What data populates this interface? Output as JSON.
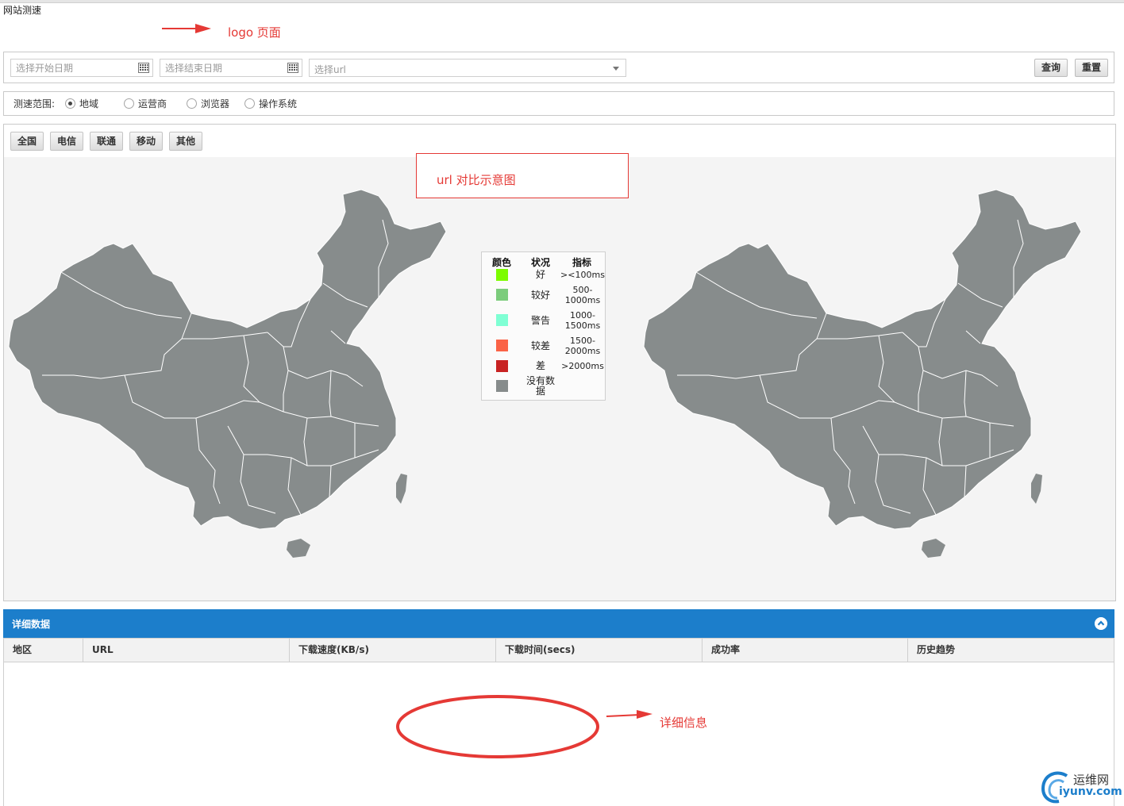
{
  "page": {
    "title": "网站测速"
  },
  "annotations": {
    "logo": "logo 页面",
    "url_compare": "url 对比示意图",
    "detail": "详细信息"
  },
  "filters": {
    "start_date_placeholder": "选择开始日期",
    "end_date_placeholder": "选择结束日期",
    "url_placeholder": "选择url",
    "query_button": "查询",
    "reset_button": "重置"
  },
  "scope": {
    "label": "测速范围:",
    "options": [
      {
        "label": "地域",
        "selected": true
      },
      {
        "label": "运营商",
        "selected": false
      },
      {
        "label": "浏览器",
        "selected": false
      },
      {
        "label": "操作系统",
        "selected": false
      }
    ]
  },
  "carrier_tabs": [
    "全国",
    "电信",
    "联通",
    "移动",
    "其他"
  ],
  "legend": {
    "headers": {
      "color": "颜色",
      "status": "状况",
      "metric": "指标"
    },
    "rows": [
      {
        "color": "#7cfc00",
        "status": "好",
        "metric": "><100ms"
      },
      {
        "color": "#7ccc7c",
        "status": "较好",
        "metric": "500-1000ms"
      },
      {
        "color": "#7fffd4",
        "status": "警告",
        "metric": "1000-1500ms"
      },
      {
        "color": "#fa6347",
        "status": "较差",
        "metric": "1500-2000ms"
      },
      {
        "color": "#c82323",
        "status": "差",
        "metric": ">2000ms"
      },
      {
        "color": "#878c8c",
        "status": "没有数据",
        "metric": ""
      }
    ]
  },
  "detail": {
    "title": "详细数据",
    "columns": [
      "地区",
      "URL",
      "下载速度(KB/s)",
      "下载时间(secs)",
      "成功率",
      "历史趋势"
    ]
  },
  "watermark": {
    "name": "运维网",
    "domain": "iyunv.com"
  },
  "colors": {
    "map_fill": "#878c8c",
    "accent": "#1c7ecb",
    "annotation": "#e53935"
  }
}
